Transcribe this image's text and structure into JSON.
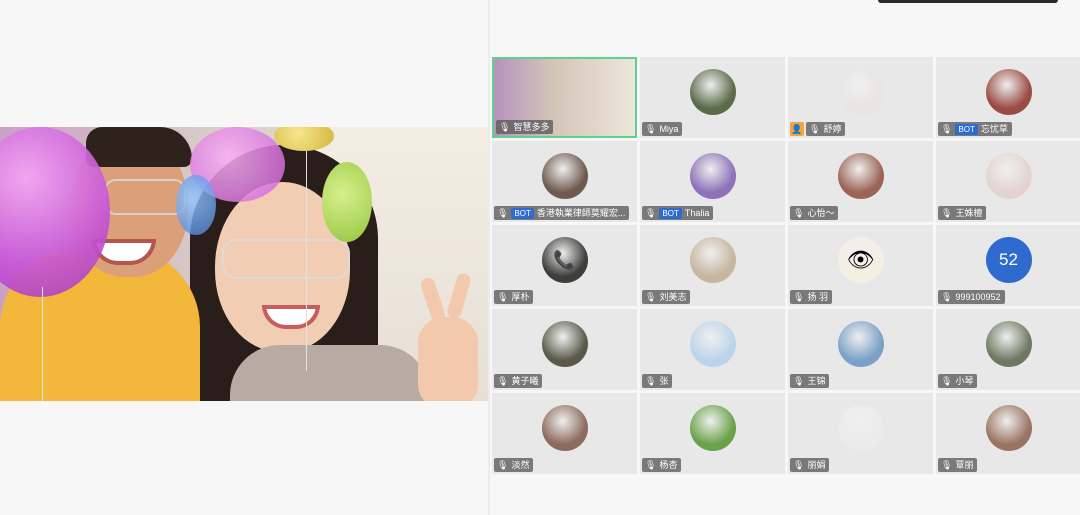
{
  "colors": {
    "accent_blue": "#2f6bcf",
    "active_border": "#5fd08e",
    "host_orange": "#f0a63b"
  },
  "speaker": {
    "description_icon": "video-feed"
  },
  "participants": [
    {
      "name": "智慧多多",
      "active": true,
      "video": true,
      "avatar_color": "#c9a6c8",
      "mic": "🎙"
    },
    {
      "name": "Miya",
      "avatar_color": "#5a6a4a",
      "mic": "🎙"
    },
    {
      "name": "舒婷",
      "host": true,
      "avatar_color": "#e8e5e2",
      "mic": "🎙"
    },
    {
      "name": "忘忧草",
      "bot": true,
      "avatar_color": "#9a4b43",
      "mic": "🎙"
    },
    {
      "name": "香港執業律師莫耀宏...",
      "bot": true,
      "avatar_color": "#6e5a4e",
      "mic": "🎙"
    },
    {
      "name": "Thalia",
      "bot": true,
      "avatar_color": "#8d72b8",
      "mic": "🎙"
    },
    {
      "name": "心怡～",
      "avatar_color": "#9b6456",
      "mic": "🎙"
    },
    {
      "name": "王姝檀",
      "avatar_color": "#e3d4cf",
      "mic": "🎙"
    },
    {
      "name": "厚朴",
      "avatar_color": "#3d3d3a",
      "icon": "phone-icon",
      "mic": "🎙"
    },
    {
      "name": "刘美志",
      "avatar_color": "#c7b59f",
      "mic": "🎙"
    },
    {
      "name": "扬 羽",
      "avatar_color": "#f4efe2",
      "icon": "eye-icon",
      "mic": "🎙"
    },
    {
      "name": "999100952",
      "avatar_number": "52",
      "mic": "🎙"
    },
    {
      "name": "黄子曦",
      "avatar_color": "#5a5a4a",
      "mic": "🎙"
    },
    {
      "name": "张",
      "avatar_color": "#bcd4ea",
      "mic": "🎙"
    },
    {
      "name": "王锦",
      "avatar_color": "#7ba1c8",
      "mic": "🎙"
    },
    {
      "name": "小琴",
      "avatar_color": "#6d7a63",
      "mic": "🎙"
    },
    {
      "name": "淡然",
      "avatar_color": "#8b6b5d",
      "mic": "🎙"
    },
    {
      "name": "杨杏",
      "avatar_color": "#6aa24b",
      "mic": "🎙"
    },
    {
      "name": "丽娟",
      "avatar_color": "#ecebeb",
      "mic": "🎙"
    },
    {
      "name": "覃丽",
      "avatar_color": "#9a7462",
      "mic": "🎙"
    }
  ],
  "labels": {
    "bot": "BOT",
    "host_badge": "👤"
  }
}
